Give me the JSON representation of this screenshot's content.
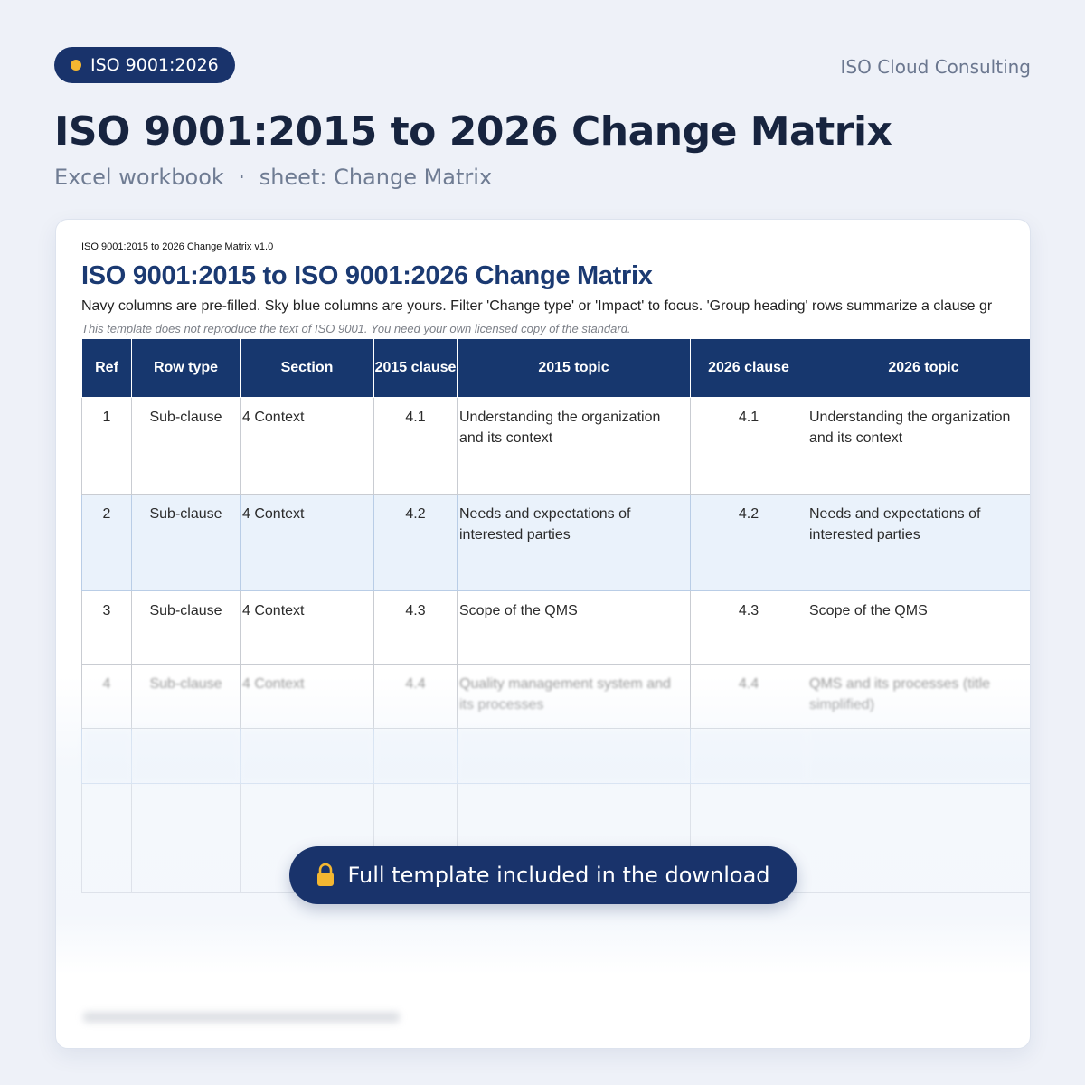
{
  "badge": {
    "label": "ISO 9001:2026"
  },
  "brand": "ISO Cloud Consulting",
  "title": "ISO 9001:2015 to 2026 Change Matrix",
  "subtitle": {
    "file_type": "Excel workbook",
    "separator": "·",
    "sheet": "sheet: Change Matrix"
  },
  "sheet": {
    "version": "ISO 9001:2015 to 2026 Change Matrix v1.0",
    "title": "ISO 9001:2015 to ISO 9001:2026 Change Matrix",
    "instructions": "Navy columns are pre-filled. Sky blue columns are yours. Filter 'Change type' or 'Impact' to focus. 'Group heading' rows summarize a clause gr",
    "disclaimer": "This template does not reproduce the text of ISO 9001. You need your own licensed copy of the standard.",
    "columns": [
      "Ref",
      "Row type",
      "Section",
      "2015 clause",
      "2015 topic",
      "2026 clause",
      "2026 topic"
    ],
    "rows": [
      [
        "1",
        "Sub-clause",
        "4 Context",
        "4.1",
        "Understanding the organization and its context",
        "4.1",
        "Understanding the organization and its context"
      ],
      [
        "2",
        "Sub-clause",
        "4 Context",
        "4.2",
        "Needs and expectations of interested parties",
        "4.2",
        "Needs and expectations of interested parties"
      ],
      [
        "3",
        "Sub-clause",
        "4 Context",
        "4.3",
        "Scope of the QMS",
        "4.3",
        "Scope of the QMS"
      ],
      [
        "4",
        "Sub-clause",
        "4 Context",
        "4.4",
        "Quality management system and its processes",
        "4.4",
        "QMS and its processes (title simplified)"
      ]
    ]
  },
  "cta": {
    "label": "Full template included in the download",
    "icon": "lock-icon"
  },
  "colors": {
    "navy": "#19336b",
    "accent": "#f4b731",
    "header": "#17376e",
    "alt_row": "#eaf2fb"
  }
}
